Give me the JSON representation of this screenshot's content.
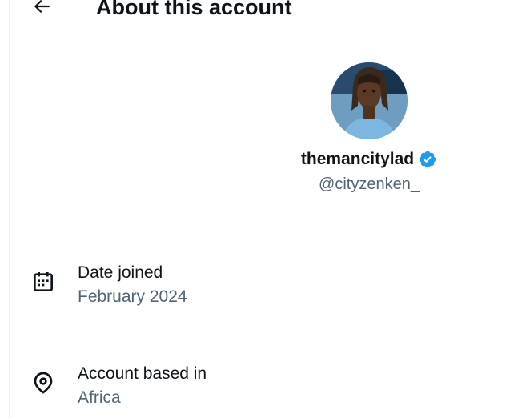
{
  "header": {
    "title": "About this account"
  },
  "profile": {
    "display_name": "themancitylad",
    "handle": "@cityzenken_",
    "verified": true
  },
  "details": [
    {
      "icon": "calendar-icon",
      "label": "Date joined",
      "value": "February 2024"
    },
    {
      "icon": "location-pin-icon",
      "label": "Account based in",
      "value": "Africa"
    }
  ],
  "colors": {
    "text_primary": "#0f1419",
    "text_secondary": "#536471",
    "verified_badge": "#1d9bf0"
  }
}
